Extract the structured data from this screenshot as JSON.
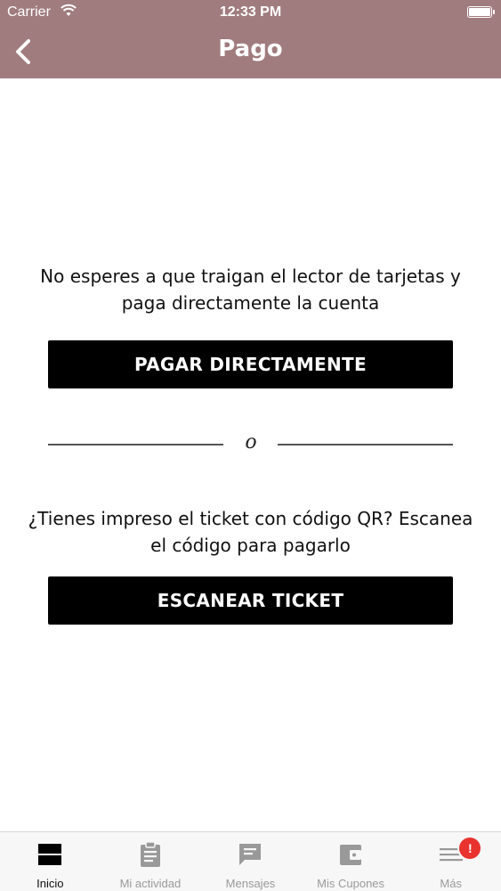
{
  "status_bar": {
    "carrier": "Carrier",
    "time": "12:33 PM"
  },
  "header": {
    "title": "Pago"
  },
  "direct_pay": {
    "message": "No esperes a que traigan el lector de tarjetas y paga directamente la cuenta",
    "button_label": "PAGAR DIRECTAMENTE"
  },
  "divider": {
    "or_text": "o"
  },
  "scan": {
    "message": "¿Tienes impreso el ticket con código QR? Escanea el código para pagarlo",
    "button_label": "ESCANEAR TICKET"
  },
  "tabbar": {
    "items": [
      {
        "label": "Inicio",
        "icon": "home-icon",
        "active": true
      },
      {
        "label": "Mi actividad",
        "icon": "clipboard-icon",
        "active": false
      },
      {
        "label": "Mensajes",
        "icon": "message-icon",
        "active": false
      },
      {
        "label": "Mis Cupones",
        "icon": "wallet-icon",
        "active": false
      },
      {
        "label": "Más",
        "icon": "menu-icon",
        "active": false,
        "badge": "!"
      }
    ]
  },
  "colors": {
    "header": "#a07c7e",
    "button": "#000000",
    "badge": "#e8332f"
  }
}
